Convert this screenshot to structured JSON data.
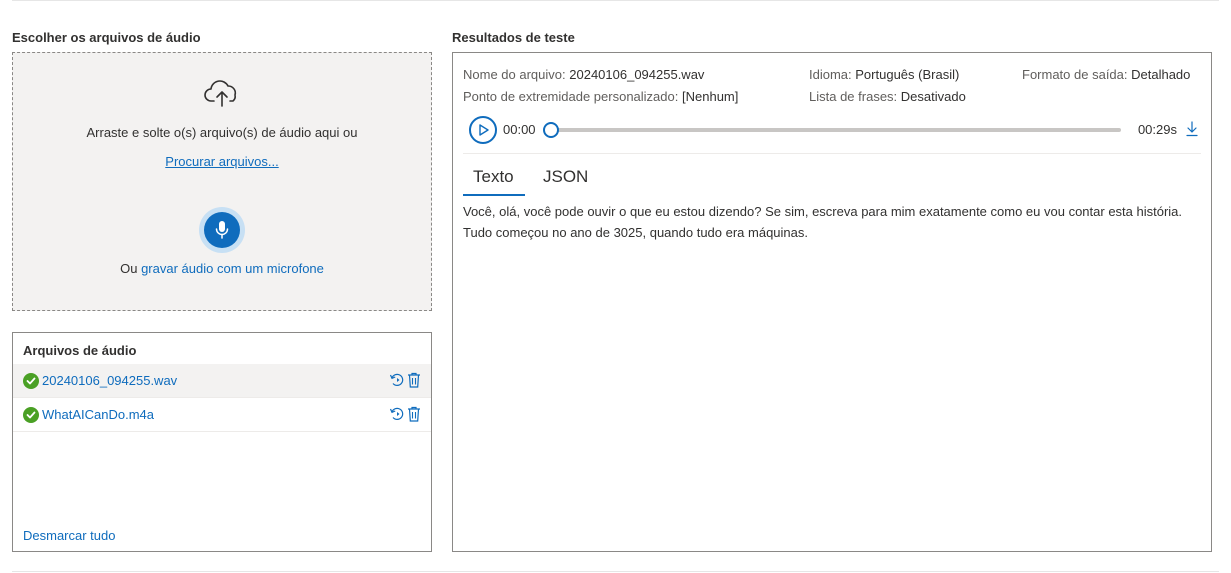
{
  "upload": {
    "section_title": "Escolher os arquivos de áudio",
    "drop_text": "Arraste e solte o(s) arquivo(s) de áudio aqui ou",
    "browse_link": "Procurar arquivos...",
    "record_prefix": "Ou ",
    "record_link": "gravar áudio com um microfone"
  },
  "files": {
    "panel_title": "Arquivos de áudio",
    "items": [
      {
        "name": "20240106_094255.wav",
        "selected": true,
        "status": "success"
      },
      {
        "name": "WhatAICanDo.m4a",
        "selected": false,
        "status": "success"
      }
    ],
    "deselect_all": "Desmarcar tudo"
  },
  "results": {
    "section_title": "Resultados de teste",
    "file_name_label": "Nome do arquivo:",
    "file_name_value": "20240106_094255.wav",
    "language_label": "Idioma:",
    "language_value": "Português (Brasil)",
    "output_format_label": "Formato de saída:",
    "output_format_value": "Detalhado",
    "endpoint_label": "Ponto de extremidade personalizado:",
    "endpoint_value": "[Nenhum]",
    "phrase_list_label": "Lista de frases:",
    "phrase_list_value": "Desativado",
    "player": {
      "current_time": "00:00",
      "total_time": "00:29s",
      "progress": 0
    },
    "tabs": [
      {
        "label": "Texto",
        "active": true
      },
      {
        "label": "JSON",
        "active": false
      }
    ],
    "transcript": "Você, olá, você pode ouvir o que eu estou dizendo? Se sim, escreva para mim exatamente como eu vou contar esta história. Tudo começou no ano de 3025, quando tudo era máquinas."
  },
  "colors": {
    "accent": "#0f6cbd",
    "success": "#4aa025",
    "dropzone_bg": "#f3f2f1",
    "border": "#8a8886"
  }
}
